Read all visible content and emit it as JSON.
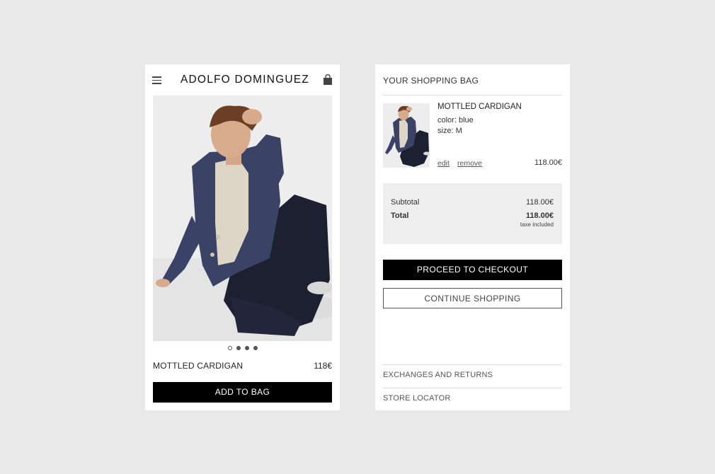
{
  "brand": "ADOLFO DOMINGUEZ",
  "icons": {
    "menu": "hamburger-menu-icon",
    "bag": "shopping-bag-icon"
  },
  "product": {
    "name": "MOTTLED CARDIGAN",
    "price": "118€",
    "add_to_bag_label": "ADD TO BAG",
    "carousel": {
      "total": 4,
      "active_index": 0
    }
  },
  "bag": {
    "title": "YOUR SHOPPING BAG",
    "item": {
      "name": "MOTTLED CARDIGAN",
      "color": "color: blue",
      "size": "size: M",
      "edit_label": "edit",
      "remove_label": "remove",
      "price": "118.00€"
    },
    "summary": {
      "subtotal_label": "Subtotal",
      "subtotal_value": "118.00€",
      "total_label": "Total",
      "total_value": "118.00€",
      "tax_note": "taxe included"
    },
    "checkout_label": "PROCEED TO CHECKOUT",
    "continue_label": "CONTINUE SHOPPING",
    "footer_links": [
      "EXCHANGES AND RETURNS",
      "STORE LOCATOR"
    ]
  },
  "colors": {
    "background": "#e9e9e9",
    "primary_button": "#000000",
    "summary_bg": "#eeeeee",
    "cardigan": "#3a4266"
  }
}
